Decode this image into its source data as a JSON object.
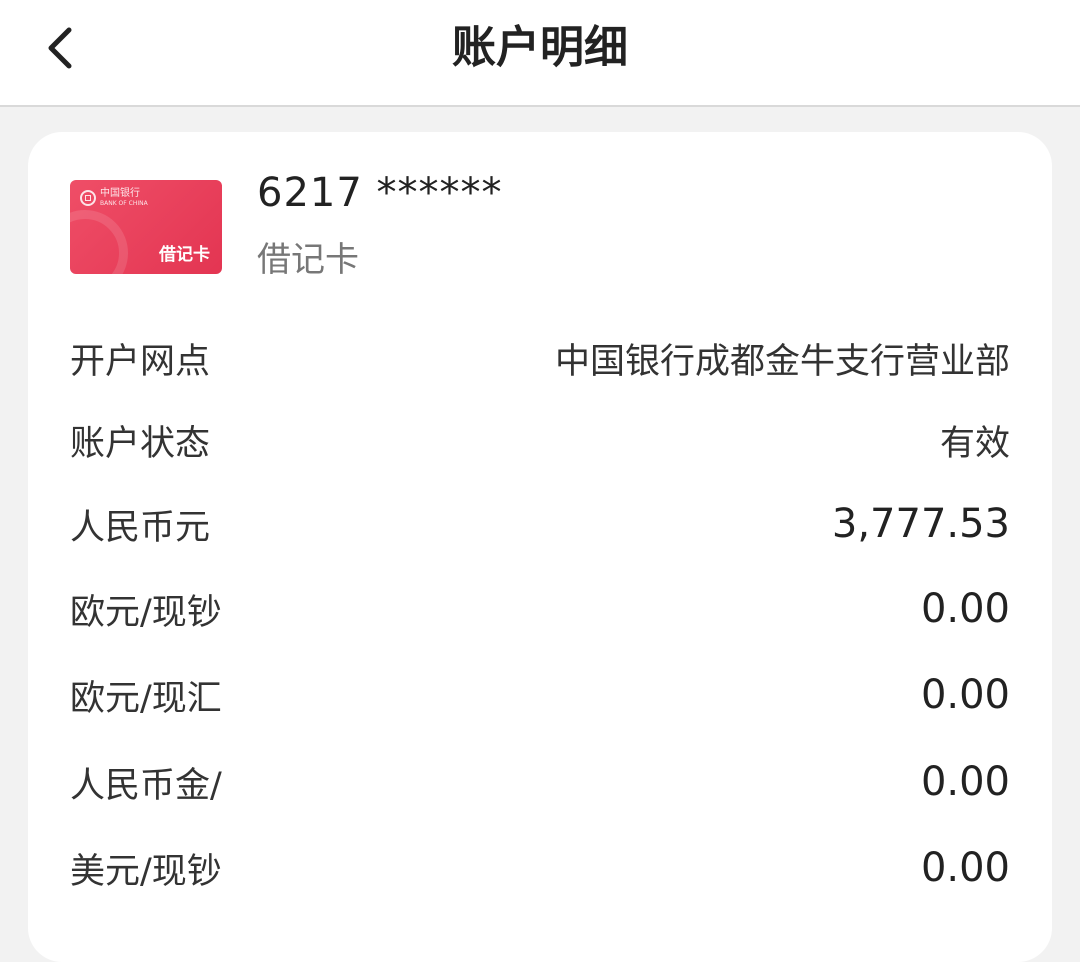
{
  "header": {
    "title": "账户明细",
    "back_icon": "chevron-left-icon"
  },
  "account": {
    "card_image": {
      "bank_name": "中国银行",
      "bank_name_en": "BANK OF CHINA",
      "type_label": "借记卡",
      "color": "#e8435d"
    },
    "number_masked": "6217 ******",
    "card_type": "借记卡"
  },
  "details": [
    {
      "label": "开户网点",
      "value": "中国银行成都金牛支行营业部"
    },
    {
      "label": "账户状态",
      "value": "有效"
    },
    {
      "label": "人民币元",
      "value": "3,777.53"
    },
    {
      "label": "欧元/现钞",
      "value": "0.00"
    },
    {
      "label": "欧元/现汇",
      "value": "0.00"
    },
    {
      "label": "人民币金/",
      "value": "0.00"
    },
    {
      "label": "美元/现钞",
      "value": "0.00"
    }
  ]
}
